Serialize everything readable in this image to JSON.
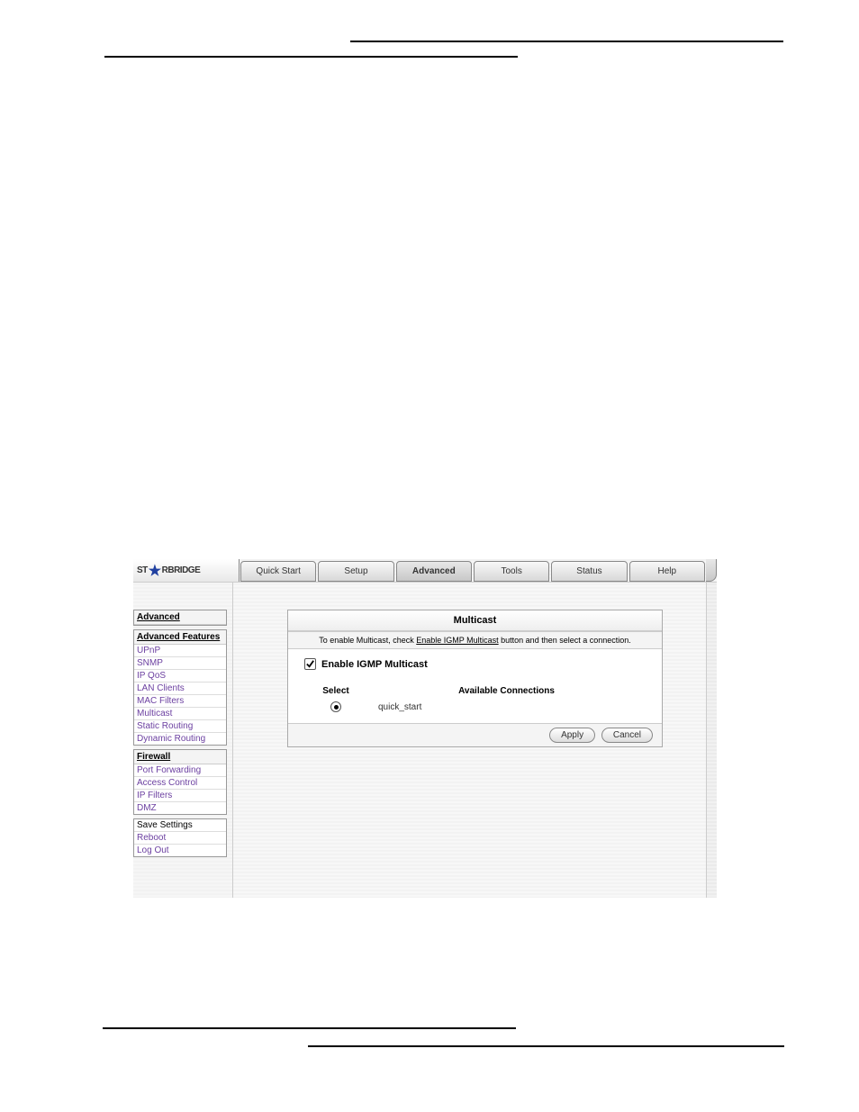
{
  "logo_prefix": "ST",
  "logo_suffix": "RBRIDGE",
  "nav": {
    "quick_start": "Quick Start",
    "setup": "Setup",
    "advanced": "Advanced",
    "tools": "Tools",
    "status": "Status",
    "help": "Help"
  },
  "sidebar": {
    "section1_title": "Advanced",
    "section2_title": "Advanced Features",
    "features": {
      "upnp": "UPnP",
      "snmp": "SNMP",
      "ipqos": "IP QoS",
      "lan_clients": "LAN Clients",
      "mac_filters": "MAC Filters",
      "multicast": "Multicast",
      "static_routing": "Static Routing",
      "dynamic_routing": "Dynamic Routing"
    },
    "firewall_title": "Firewall",
    "firewall": {
      "port_forwarding": "Port Forwarding",
      "access_control": "Access Control",
      "ip_filters": "IP Filters",
      "dmz": "DMZ"
    },
    "actions": {
      "save": "Save Settings",
      "reboot": "Reboot",
      "logout": "Log Out"
    }
  },
  "panel": {
    "title": "Multicast",
    "desc_prefix": "To enable Multicast, check ",
    "desc_link": "Enable IGMP Multicast",
    "desc_suffix": " button and then select a connection.",
    "checkbox_label": "Enable IGMP Multicast",
    "col_select": "Select",
    "col_available": "Available Connections",
    "connection_name": "quick_start",
    "apply": "Apply",
    "cancel": "Cancel"
  }
}
